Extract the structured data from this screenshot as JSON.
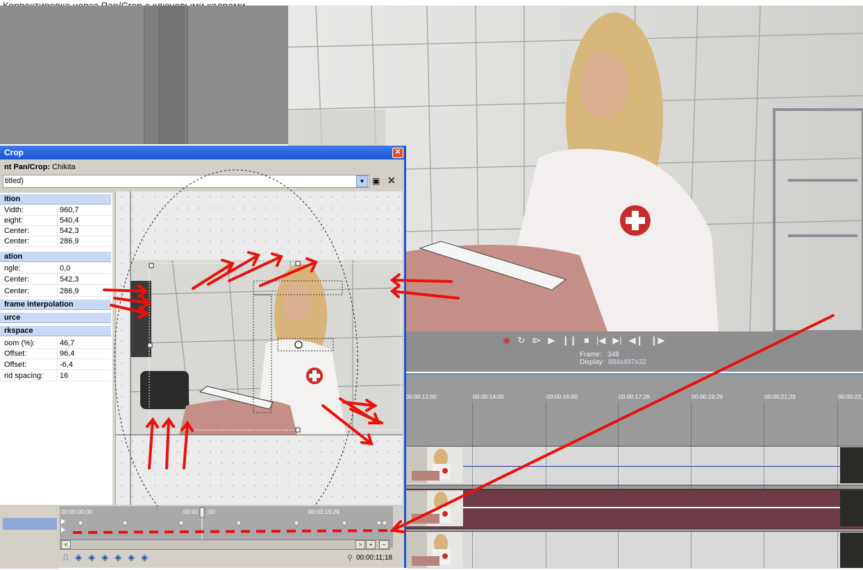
{
  "caption": "Корректировка через Pan/Crop с ключевыми кадрами",
  "dialog": {
    "title": "Crop",
    "subtitle_prefix": "nt Pan/Crop:",
    "subtitle_value": " Chikita",
    "preset": "titled)"
  },
  "properties": {
    "position": {
      "header": "ition",
      "rows": [
        {
          "label": "Vidth:",
          "value": "960,7"
        },
        {
          "label": "eight:",
          "value": "540,4"
        },
        {
          "label": "Center:",
          "value": "542,3"
        },
        {
          "label": "Center:",
          "value": "286,9"
        }
      ]
    },
    "rotation": {
      "header": "ation",
      "rows": [
        {
          "label": "ngle:",
          "value": "0,0"
        },
        {
          "label": "Center:",
          "value": "542,3"
        },
        {
          "label": "Center:",
          "value": "286,9"
        }
      ]
    },
    "keyframe_interp": {
      "header": "frame interpolation"
    },
    "source": {
      "header": "urce"
    },
    "workspace": {
      "header": "rkspace",
      "rows": [
        {
          "label": "oom (%):",
          "value": "46,7"
        },
        {
          "label": "Offset:",
          "value": "96,4"
        },
        {
          "label": "Offset:",
          "value": "-6,4"
        },
        {
          "label": "rid spacing:",
          "value": "16"
        }
      ]
    }
  },
  "keyframes": {
    "ruler": [
      "00:00:00;00",
      "00:00",
      ";00",
      "00:00:19;29"
    ],
    "current_time": "00:00:11;18",
    "scroll_buttons": [
      "<",
      ">",
      "+",
      "−"
    ]
  },
  "transport": {
    "buttons": [
      "record-icon",
      "loop-icon",
      "play-from-start-icon",
      "play-icon",
      "pause-icon",
      "stop-icon",
      "prev-marker-icon",
      "next-marker-icon",
      "prev-frame-icon",
      "next-frame-icon"
    ],
    "glyphs": [
      "◉",
      "↻",
      "⧐",
      "▶",
      "❙❙",
      "■",
      "|◀",
      "▶|",
      "◀❙",
      "❙▶"
    ],
    "frame_label": "Frame:",
    "frame_value": "348",
    "display_label": "Display:",
    "display_value": "884x497x32"
  },
  "timeline": {
    "ruler": [
      "00:00:12;00",
      "00:00:14;00",
      "00:00:16;00",
      "00:00:17;29",
      "00:00:19;29",
      "00:00:21;29",
      "00:00:23;"
    ]
  },
  "colors": {
    "dialog_title": "#1a54cf",
    "annotation_red": "#e8110c",
    "clip_selected": "#6f3b46",
    "property_header": "#c7d9f7"
  }
}
